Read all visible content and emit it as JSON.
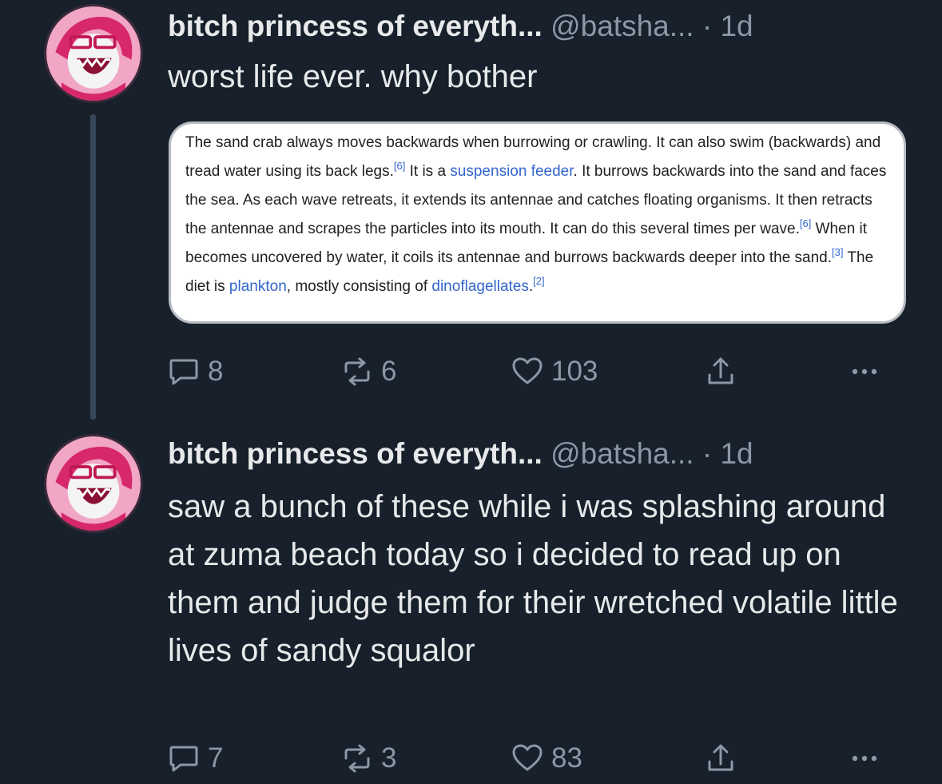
{
  "tweets": [
    {
      "author_name": "bitch princess of everyth...",
      "handle": "@batsha...",
      "separator": "·",
      "time": "1d",
      "text": "worst life ever. why bother",
      "embedded_card": {
        "segments": [
          "The sand crab always moves backwards when burrowing or crawling. It can also swim (backwards) and tread water using its back legs.",
          "[6]",
          " It is a ",
          "suspension feeder",
          ". It burrows backwards into the sand and faces the sea. As each wave retreats, it extends its antennae and catches floating organisms. It then retracts the antennae and scrapes the particles into its mouth. It can do this several times per wave.",
          "[6]",
          " When it becomes uncovered by water, it coils its antennae and burrows backwards deeper into the sand.",
          "[3]",
          " The diet is ",
          "plankton",
          ", mostly consisting of ",
          "dinoflagellates",
          ".",
          "[2]"
        ]
      },
      "actions": {
        "replies": "8",
        "retweets": "6",
        "likes": "103"
      }
    },
    {
      "author_name": "bitch princess of everyth...",
      "handle": "@batsha...",
      "separator": "·",
      "time": "1d",
      "text": "saw a bunch of these while i was splashing around at zuma beach today so i decided to read up on them and judge them for their wretched volatile little lives of sandy squalor",
      "actions": {
        "replies": "7",
        "retweets": "3",
        "likes": "83"
      }
    }
  ],
  "icons": {
    "reply": "speech-bubble-icon",
    "retweet": "retweet-arrows-icon",
    "like": "heart-outline-icon",
    "share": "share-upload-icon",
    "more": "ellipsis-icon"
  },
  "colors": {
    "background": "#17202b",
    "text_primary": "#e7e9ea",
    "text_secondary": "#8b98a5",
    "thread_line": "#37475a",
    "wiki_link": "#3366cc"
  }
}
